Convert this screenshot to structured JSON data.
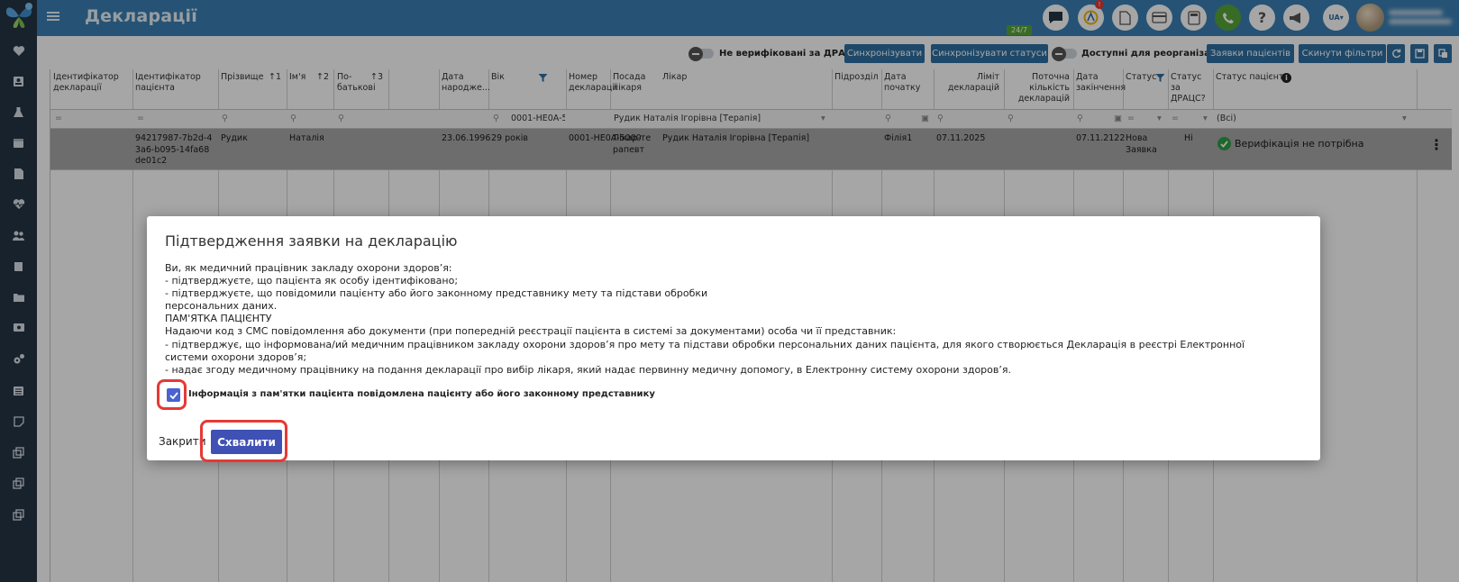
{
  "header": {
    "title": "Декларації",
    "chat_badge": "24/7",
    "notification_count": "!",
    "language": "UA▾"
  },
  "toolbar": {
    "not_verified_label": "Не верифіковані за ДРАЦС",
    "sync_label": "Синхронізувати",
    "sync_statuses_label": "Синхронізувати статуси",
    "reorg_label": "Доступні для реорганізації",
    "patient_requests_label": "Заявки пацієнтів",
    "reset_filters_label": "Скинути фільтри"
  },
  "table": {
    "columns": [
      "Ідентифікатор декларації",
      "Ідентифікатор пацієнта",
      "Прізвище",
      "Ім'я",
      "По-батькові",
      "Дата народже...",
      "Вік",
      "Номер декларації",
      "Посада лікаря",
      "Лікар",
      "Підрозділ",
      "Дата початку",
      "Ліміт декларацій",
      "Поточна кількість декларацій",
      "Дата закінчення",
      "Статус",
      "Статус за ДРАЦС?",
      "Статус пацієнта"
    ],
    "sort_marks": {
      "surname": "1",
      "name": "2",
      "patronymic": "3"
    },
    "filters": {
      "eq": "=",
      "declaration_number": "0001-HE0A-5",
      "doctor": "Рудик Наталія Ігорівна [Терапія]",
      "patient_status": "(Всі)"
    },
    "row": {
      "patient_id": "94217987-7b2d-43a6-b095-14fa68de01c2",
      "surname": "Рудик",
      "name": "Наталія",
      "birth_date": "23.06.1996",
      "age": "29 років",
      "declaration_number": "0001-HE0A-5000",
      "doctor_position": "Лікар-терапевт",
      "doctor": "Рудик Наталія Ігорівна [Терапія]",
      "division": "Філія1",
      "start_date": "07.11.2025",
      "end_date": "07.11.2122",
      "status": "Нова Заявка",
      "dracs_status": "Ні",
      "patient_status": "Верифікація не потрібна"
    }
  },
  "dialog": {
    "title": "Підтвердження заявки на декларацію",
    "body": "Ви, як медичний працівник закладу охорони здоров’я:\n- підтверджуєте, що пацієнта як особу ідентифіковано;\n- підтверджуєте, що повідомили пацієнту або його законному представнику мету та підстави обробки\nперсональних даних.\nПАМ'ЯТКА ПАЦІЄНТУ\nНадаючи код з СМС повідомлення або документи (при попередній реєстрації пацієнта в системі за документами) особа чи її представник:\n- підтверджує, що інформована/ий медичним працівником закладу охорони здоров’я про мету та підстави обробки персональних даних пацієнта, для якого створюється Декларація в реєстрі Електронної системи охорони здоров’я;\n- надає згоду медичному працівнику на подання декларації про вибір лікаря, який надає первинну медичну допомогу, в Електронну систему охорони здоров’я.",
    "checkbox_label": "Інформація з пам'ятки пацієнта повідомлена пацієнту або його законному представнику",
    "checked": true,
    "close_label": "Закрити",
    "approve_label": "Схвалити"
  },
  "colors": {
    "header": "#3b80b4",
    "sidebar": "#263545",
    "button": "#2f6fa2",
    "approve": "#3f51b5",
    "highlight": "#e53935"
  }
}
